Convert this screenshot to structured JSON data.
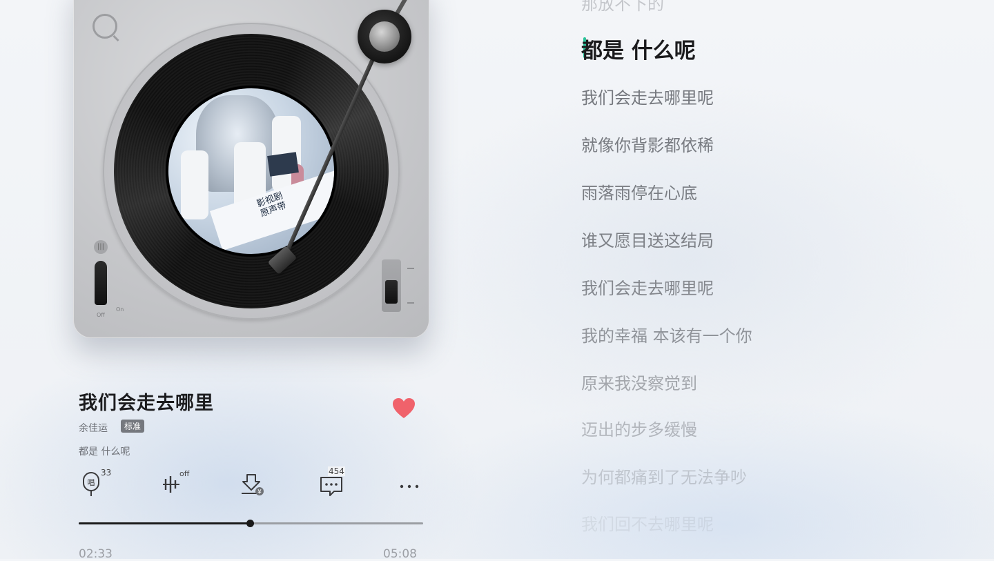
{
  "player": {
    "song_title": "我们会走去哪里",
    "artist": "余佳运",
    "quality_badge": "标准",
    "current_lyric": "都是 什么呢",
    "album_cover_text": "影视剧\n原声带",
    "turntable": {
      "switch_off_label": "Off",
      "switch_on_label": "On"
    },
    "liked": true,
    "colors": {
      "like": "#f0626b",
      "accent": "#2bc39a"
    }
  },
  "actions": {
    "sing": {
      "icon": "microphone-sing-icon",
      "count": "33"
    },
    "sound_effect": {
      "icon": "sound-effect-icon",
      "status": "off"
    },
    "download": {
      "icon": "download-icon"
    },
    "comments": {
      "icon": "comment-icon",
      "count": "454"
    },
    "more": {
      "icon": "more-icon"
    }
  },
  "progress": {
    "current_time": "02:33",
    "total_time": "05:08",
    "fraction": 0.497
  },
  "lyrics": {
    "active_index": 1,
    "lines": [
      {
        "text": "那放不下的",
        "opacity": 0.35
      },
      {
        "text": "都是 什么呢",
        "opacity": 1
      },
      {
        "text": "我们会走去哪里呢",
        "opacity": 0.95
      },
      {
        "text": "就像你背影都依稀",
        "opacity": 0.92
      },
      {
        "text": "雨落雨停在心底",
        "opacity": 0.9
      },
      {
        "text": "谁又愿目送这结局",
        "opacity": 0.88
      },
      {
        "text": "我们会走去哪里呢",
        "opacity": 0.82
      },
      {
        "text": "我的幸福 本该有一个你",
        "opacity": 0.72
      },
      {
        "text": "原来我没察觉到",
        "opacity": 0.58
      },
      {
        "text": "迈出的步多缓慢",
        "opacity": 0.45
      },
      {
        "text": "为何都痛到了无法争吵",
        "opacity": 0.3
      },
      {
        "text": "我们回不去哪里呢",
        "opacity": 0.12
      }
    ]
  }
}
